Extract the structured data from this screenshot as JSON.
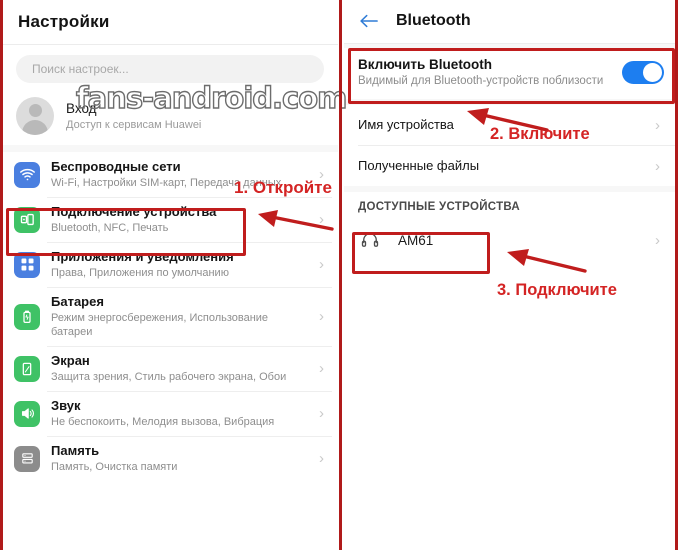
{
  "watermark": {
    "text": "fans-android.com"
  },
  "left_panel": {
    "title": "Настройки",
    "search": {
      "placeholder": "Поиск настроек..."
    },
    "account": {
      "name": "Вход",
      "subtitle": "Доступ к сервисам Huawei",
      "avatar_name": "avatar"
    },
    "items": [
      {
        "title": "Беспроводные сети",
        "subtitle": "Wi-Fi, Настройки SIM-карт, Передача данных",
        "icon": "wifi-icon",
        "icon_color": "#4a7fe0"
      },
      {
        "title": "Подключение устройства",
        "subtitle": "Bluetooth, NFC, Печать",
        "icon": "device-connection-icon",
        "icon_color": "#3fc266"
      },
      {
        "title": "Приложения и уведомления",
        "subtitle": "Права, Приложения по умолчанию",
        "icon": "apps-grid-icon",
        "icon_color": "#4a7fe0"
      },
      {
        "title": "Батарея",
        "subtitle": "Режим энергосбережения, Использование батареи",
        "icon": "battery-icon",
        "icon_color": "#3fc266"
      },
      {
        "title": "Экран",
        "subtitle": "Защита зрения, Стиль рабочего экрана, Обои",
        "icon": "display-icon",
        "icon_color": "#3fc266"
      },
      {
        "title": "Звук",
        "subtitle": "Не беспокоить, Мелодия вызова, Вибрация",
        "icon": "sound-icon",
        "icon_color": "#3fc266"
      },
      {
        "title": "Память",
        "subtitle": "Память, Очистка памяти",
        "icon": "storage-icon",
        "icon_color": "#8c8c8c"
      }
    ],
    "chevron": "›"
  },
  "right_panel": {
    "header": {
      "title": "Bluetooth",
      "back_icon": "back-arrow-icon"
    },
    "enable": {
      "title": "Включить Bluetooth",
      "subtitle": "Видимый для Bluetooth-устройств поблизости",
      "toggle_state": "on",
      "toggle_color": "#1d7ef0"
    },
    "rows": [
      {
        "title": "Имя устройства"
      },
      {
        "title": "Полученные файлы"
      }
    ],
    "available_label": "ДОСТУПНЫЕ УСТРОЙСТВА",
    "devices": [
      {
        "name": "AM61",
        "icon": "headset-icon"
      }
    ],
    "chevron": "›"
  },
  "annotations": {
    "accent_color": "#c01d1d",
    "steps": [
      {
        "label": "1. Откройте"
      },
      {
        "label": "2. Включите"
      },
      {
        "label": "3. Подключите"
      }
    ]
  }
}
